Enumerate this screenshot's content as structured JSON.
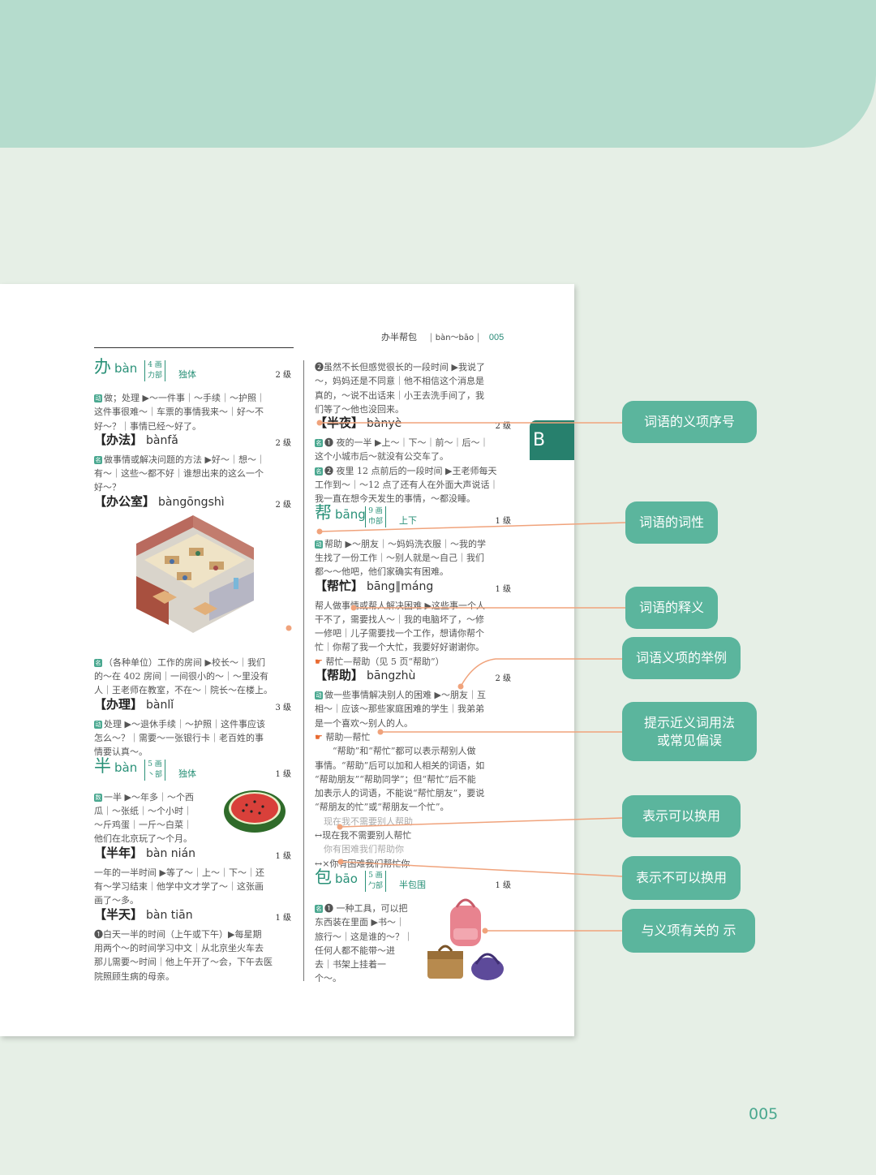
{
  "runhead": {
    "title": "办半帮包",
    "pinyin": "bàn～bāo",
    "page": "005"
  },
  "section_tab": "B",
  "footer_page": "005",
  "left_col": [
    {
      "type": "char",
      "char": "办",
      "py": "bàn",
      "meta1": "4 画",
      "meta2": "力部",
      "extra": "独体",
      "level": "2 级"
    },
    {
      "type": "line",
      "pos": "动",
      "text": "做；处理 ▶～一件事｜～手续｜～护照｜"
    },
    {
      "type": "line",
      "text": "这件事很难～｜车票的事情我来～｜好～不"
    },
    {
      "type": "line",
      "text": "好～？｜事情已经～好了。"
    },
    {
      "type": "head",
      "word": "【办法】",
      "py": "bànfǎ",
      "level": "2 级"
    },
    {
      "type": "line",
      "pos": "名",
      "text": "做事情或解决问题的方法 ▶好～｜想～｜"
    },
    {
      "type": "line",
      "text": "有～｜这些～都不好｜谁想出来的这么一个"
    },
    {
      "type": "line",
      "text": "好～？"
    },
    {
      "type": "head",
      "word": "【办公室】",
      "py": "bàngōngshì",
      "level": "2 级"
    },
    {
      "type": "img",
      "name": "office-illustration"
    },
    {
      "type": "line",
      "pos": "名",
      "text": "（各种单位）工作的房间 ▶校长～｜我们"
    },
    {
      "type": "line",
      "text": "的～在 402 房间｜一间很小的～｜～里没有"
    },
    {
      "type": "line",
      "text": "人｜王老师在教室，不在～｜院长～在楼上。"
    },
    {
      "type": "head",
      "word": "【办理】",
      "py": "bànlǐ",
      "level": "3 级"
    },
    {
      "type": "line",
      "pos": "动",
      "text": "处理 ▶～退休手续｜～护照｜这件事应该"
    },
    {
      "type": "line",
      "text": "怎么～？｜需要～一张银行卡｜老百姓的事"
    },
    {
      "type": "line",
      "text": "情要认真～。"
    },
    {
      "type": "char",
      "char": "半",
      "py": "bàn",
      "meta1": "5 画",
      "meta2": "丶部",
      "extra": "独体",
      "level": "1 级"
    },
    {
      "type": "line",
      "pos": "数",
      "text": "一半 ▶～年多｜～个西",
      "short": true
    },
    {
      "type": "line",
      "text": "瓜｜～张纸｜～个小时｜",
      "short": true
    },
    {
      "type": "line",
      "text": "～斤鸡蛋｜一斤～白菜｜",
      "short": true
    },
    {
      "type": "line",
      "text": "他们在北京玩了～个月。",
      "short": true
    },
    {
      "type": "head",
      "word": "【半年】",
      "py": "bàn nián",
      "level": "1 级"
    },
    {
      "type": "line",
      "text": "一年的一半时间 ▶等了～｜上～｜下～｜还"
    },
    {
      "type": "line",
      "text": "有～学习结束｜他学中文才学了～｜这张画"
    },
    {
      "type": "line",
      "text": "画了～多。"
    },
    {
      "type": "head",
      "word": "【半天】",
      "py": "bàn tiān",
      "level": "1 级"
    },
    {
      "type": "line",
      "text": "❶白天一半的时间（上午或下午）▶每星期"
    },
    {
      "type": "line",
      "text": "用两个～的时间学习中文｜从北京坐火车去"
    },
    {
      "type": "line",
      "text": "那儿需要～时间｜他上午开了～会，下午去医"
    },
    {
      "type": "line",
      "text": "院照顾生病的母亲。"
    }
  ],
  "right_col": [
    {
      "type": "line",
      "text": "❷虽然不长但感觉很长的一段时间 ▶我说了"
    },
    {
      "type": "line",
      "text": "～，妈妈还是不同意｜他不相信这个消息是"
    },
    {
      "type": "line",
      "text": "真的，～说不出话来｜小王去洗手间了，我"
    },
    {
      "type": "line",
      "text": "们等了～他也没回来。"
    },
    {
      "type": "head",
      "word": "【半夜】",
      "py": "bànyè",
      "level": "2 级"
    },
    {
      "type": "line",
      "pos": "名",
      "text": "❶ 夜的一半 ▶上～｜下～｜前～｜后～｜"
    },
    {
      "type": "line",
      "text": "这个小城市后～就没有公交车了。"
    },
    {
      "type": "line",
      "pos": "名",
      "text": "❷ 夜里 12 点前后的一段时间 ▶王老师每天"
    },
    {
      "type": "line",
      "text": "工作到～｜～12 点了还有人在外面大声说话｜"
    },
    {
      "type": "line",
      "text": "我一直在想今天发生的事情，～都没睡。"
    },
    {
      "type": "char",
      "char": "帮",
      "py": "bāng",
      "meta1": "9 画",
      "meta2": "巾部",
      "extra": "上下",
      "level": "1 级"
    },
    {
      "type": "line",
      "pos": "动",
      "text": "帮助 ▶～朋友｜～妈妈洗衣服｜～我的学"
    },
    {
      "type": "line",
      "text": "生找了一份工作｜～别人就是～自己｜我们"
    },
    {
      "type": "line",
      "text": "都～～他吧，他们家确实有困难。"
    },
    {
      "type": "head",
      "word": "【帮忙】",
      "py": "bāng∥máng",
      "level": "1 级"
    },
    {
      "type": "line",
      "text": "帮人做事情或帮人解决困难 ▶这些事一个人"
    },
    {
      "type": "line",
      "text": "干不了，需要找人～｜我的电脑坏了，～修"
    },
    {
      "type": "line",
      "text": "一修吧｜儿子需要找一个工作，想请你帮个"
    },
    {
      "type": "line",
      "text": "忙｜你帮了我一个大忙，我要好好谢谢你。"
    },
    {
      "type": "note",
      "text": "帮忙—帮助（见 5 页“帮助”）"
    },
    {
      "type": "head",
      "word": "【帮助】",
      "py": "bāngzhù",
      "level": "2 级"
    },
    {
      "type": "line",
      "pos": "动",
      "text": "做一些事情解决别人的困难 ▶～朋友｜互"
    },
    {
      "type": "line",
      "text": "相～｜应该～那些家庭困难的学生｜我弟弟"
    },
    {
      "type": "line",
      "text": "是一个喜欢～别人的人。"
    },
    {
      "type": "note",
      "text": "帮助—帮忙"
    },
    {
      "type": "line",
      "text": "　　“帮助”和“帮忙”都可以表示帮别人做"
    },
    {
      "type": "line",
      "text": "事情。“帮助”后可以加和人相关的词语，如"
    },
    {
      "type": "line",
      "text": "“帮助朋友”“帮助同学”；但“帮忙”后不能"
    },
    {
      "type": "line",
      "text": "加表示人的词语，不能说“帮忙朋友”，要说"
    },
    {
      "type": "line",
      "text": "“帮朋友的忙”或“帮朋友一个忙”。"
    },
    {
      "type": "line",
      "text": "　现在我不需要别人帮助",
      "faint": true
    },
    {
      "type": "line",
      "text": "↔现在我不需要别人帮忙"
    },
    {
      "type": "line",
      "text": "　你有困难我们帮助你",
      "faint": true
    },
    {
      "type": "line",
      "text": "↔×你有困难我们帮忙你"
    },
    {
      "type": "char",
      "char": "包",
      "py": "bāo",
      "meta1": "5 画",
      "meta2": "勹部",
      "extra": "半包围",
      "level": "1 级"
    },
    {
      "type": "line",
      "pos": "名",
      "text": "❶ 一种工具，可以把",
      "short": true
    },
    {
      "type": "line",
      "text": "东西装在里面 ▶书～｜",
      "short": true
    },
    {
      "type": "line",
      "text": "旅行～｜这是谁的～？｜",
      "short": true
    },
    {
      "type": "line",
      "text": "任何人都不能带～进",
      "short": true
    },
    {
      "type": "line",
      "text": "去｜书架上挂着一",
      "short": true
    },
    {
      "type": "line",
      "text": "个～。",
      "short": true
    }
  ],
  "callouts": [
    {
      "label": "词语的义项序号"
    },
    {
      "label": "词语的词性"
    },
    {
      "label": "词语的释义"
    },
    {
      "label": "词语义项的举例"
    },
    {
      "label": "提示近义词用法\n或常见偏误"
    },
    {
      "label": "表示可以换用"
    },
    {
      "label": "表示不可以换用"
    },
    {
      "label": "与义项有关的 示"
    }
  ],
  "colors": {
    "accent": "#5bb59d",
    "dark_accent": "#27806d",
    "top_band": "#b5dccd",
    "bg": "#e6efe6",
    "pointer": "#f0a37c"
  }
}
